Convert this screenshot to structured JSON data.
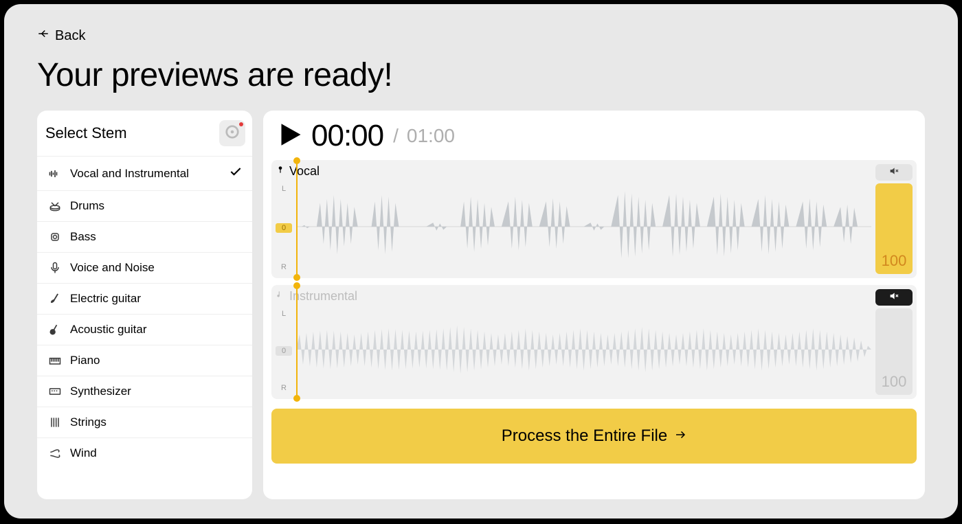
{
  "back_label": "Back",
  "page_title": "Your previews are ready!",
  "stem_panel": {
    "title": "Select Stem",
    "items": [
      {
        "label": "Vocal and Instrumental",
        "selected": true
      },
      {
        "label": "Drums",
        "selected": false
      },
      {
        "label": "Bass",
        "selected": false
      },
      {
        "label": "Voice and Noise",
        "selected": false
      },
      {
        "label": "Electric guitar",
        "selected": false
      },
      {
        "label": "Acoustic guitar",
        "selected": false
      },
      {
        "label": "Piano",
        "selected": false
      },
      {
        "label": "Synthesizer",
        "selected": false
      },
      {
        "label": "Strings",
        "selected": false
      },
      {
        "label": "Wind",
        "selected": false
      }
    ]
  },
  "player": {
    "current_time": "00:00",
    "total_time": "01:00",
    "separator": "/",
    "pan_left_label": "L",
    "pan_center_label": "0",
    "pan_right_label": "R",
    "tracks": [
      {
        "title": "Vocal",
        "muted": false,
        "volume": "100"
      },
      {
        "title": "Instrumental",
        "muted": true,
        "volume": "100"
      }
    ]
  },
  "process_button_label": "Process the Entire File"
}
